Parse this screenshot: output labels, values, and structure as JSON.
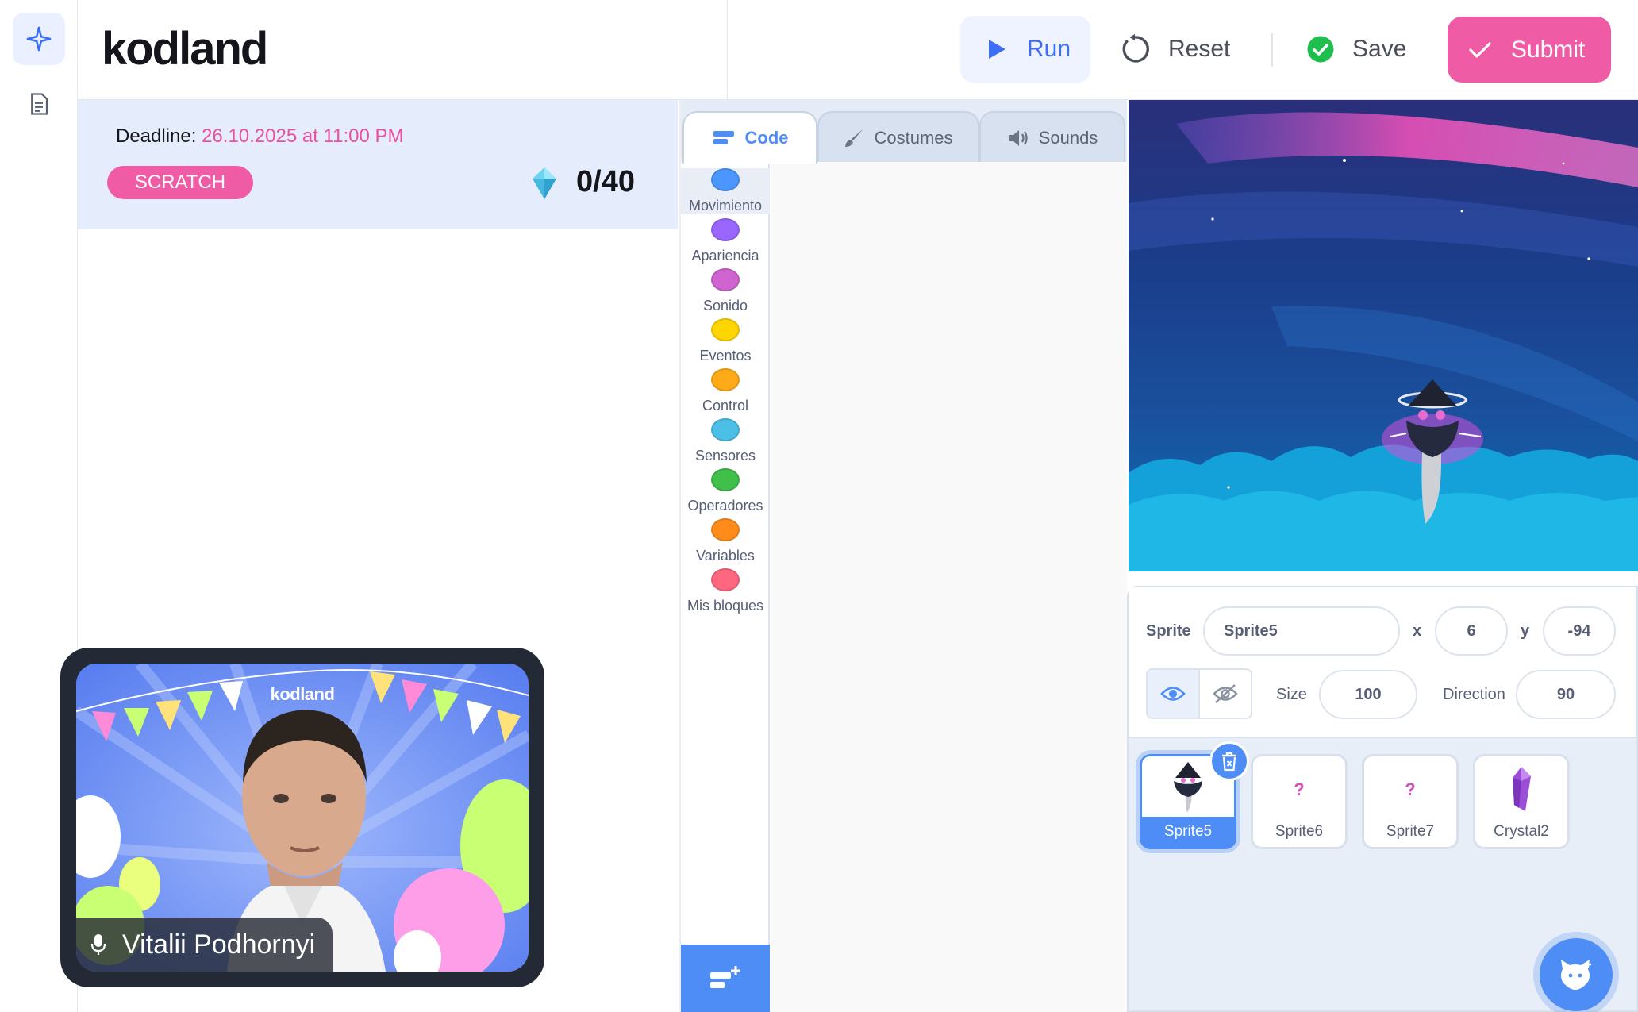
{
  "app": {
    "brand": "kodland"
  },
  "rail": {
    "items": [
      {
        "icon": "sparkle-icon",
        "active": true
      },
      {
        "icon": "document-icon",
        "active": false
      }
    ]
  },
  "toolbar": {
    "run_label": "Run",
    "reset_label": "Reset",
    "save_label": "Save",
    "submit_label": "Submit"
  },
  "task": {
    "deadline_label": "Deadline:",
    "deadline_value": "26.10.2025 at 11:00 PM",
    "tag": "SCRATCH",
    "score": "0/40"
  },
  "video": {
    "logo": "kodland",
    "participant": "Vitalii Podhornyi"
  },
  "editor": {
    "tabs": [
      {
        "label": "Code",
        "icon": "code-icon"
      },
      {
        "label": "Costumes",
        "icon": "brush-icon"
      },
      {
        "label": "Sounds",
        "icon": "speaker-icon"
      }
    ],
    "categories": [
      {
        "label": "Movimiento",
        "color": "#4c97ff"
      },
      {
        "label": "Apariencia",
        "color": "#9966ff"
      },
      {
        "label": "Sonido",
        "color": "#cf63cf"
      },
      {
        "label": "Eventos",
        "color": "#ffd500"
      },
      {
        "label": "Control",
        "color": "#ffab19"
      },
      {
        "label": "Sensores",
        "color": "#4cbfe6"
      },
      {
        "label": "Operadores",
        "color": "#40bf4a"
      },
      {
        "label": "Variables",
        "color": "#ff8c1a"
      },
      {
        "label": "Mis bloques",
        "color": "#ff6680"
      }
    ]
  },
  "sprite_info": {
    "sprite_label": "Sprite",
    "sprite_name": "Sprite5",
    "x_label": "x",
    "x": "6",
    "y_label": "y",
    "y": "-94",
    "size_label": "Size",
    "size": "100",
    "direction_label": "Direction",
    "direction": "90"
  },
  "sprites": [
    {
      "name": "Sprite5",
      "selected": true
    },
    {
      "name": "Sprite6",
      "selected": false
    },
    {
      "name": "Sprite7",
      "selected": false
    },
    {
      "name": "Crystal2",
      "selected": false
    }
  ],
  "colors": {
    "accent": "#4d8df5",
    "pink": "#ef5ca5",
    "run_blue": "#3e6ef5",
    "save_green": "#1fbf4f"
  }
}
